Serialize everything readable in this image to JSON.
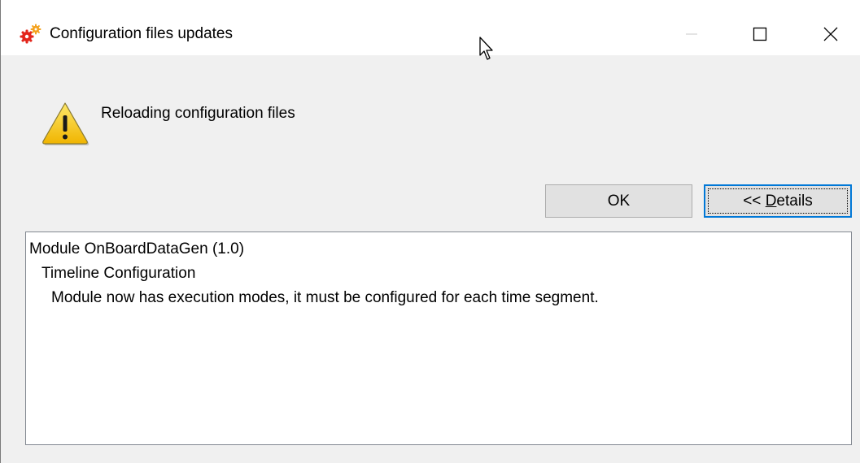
{
  "window": {
    "title": "Configuration files updates",
    "app_icon": "gears-icon",
    "controls": {
      "minimize": "minimize-icon",
      "maximize": "maximize-icon",
      "close": "close-icon"
    }
  },
  "dialog": {
    "icon": "warning-icon",
    "message": "Reloading configuration files",
    "buttons": {
      "ok_label": "OK",
      "details_prefix": "<< ",
      "details_mnemonic": "D",
      "details_rest": "etails"
    }
  },
  "details": {
    "lines": [
      "Module OnBoardDataGen (1.0)",
      "Timeline Configuration",
      "Module now has execution modes, it must be configured for each time segment."
    ]
  },
  "colors": {
    "background": "#f0f0f0",
    "titlebar": "#ffffff",
    "button_face": "#e1e1e1",
    "focus_border": "#0078d7",
    "warning_yellow": "#f7c900"
  }
}
